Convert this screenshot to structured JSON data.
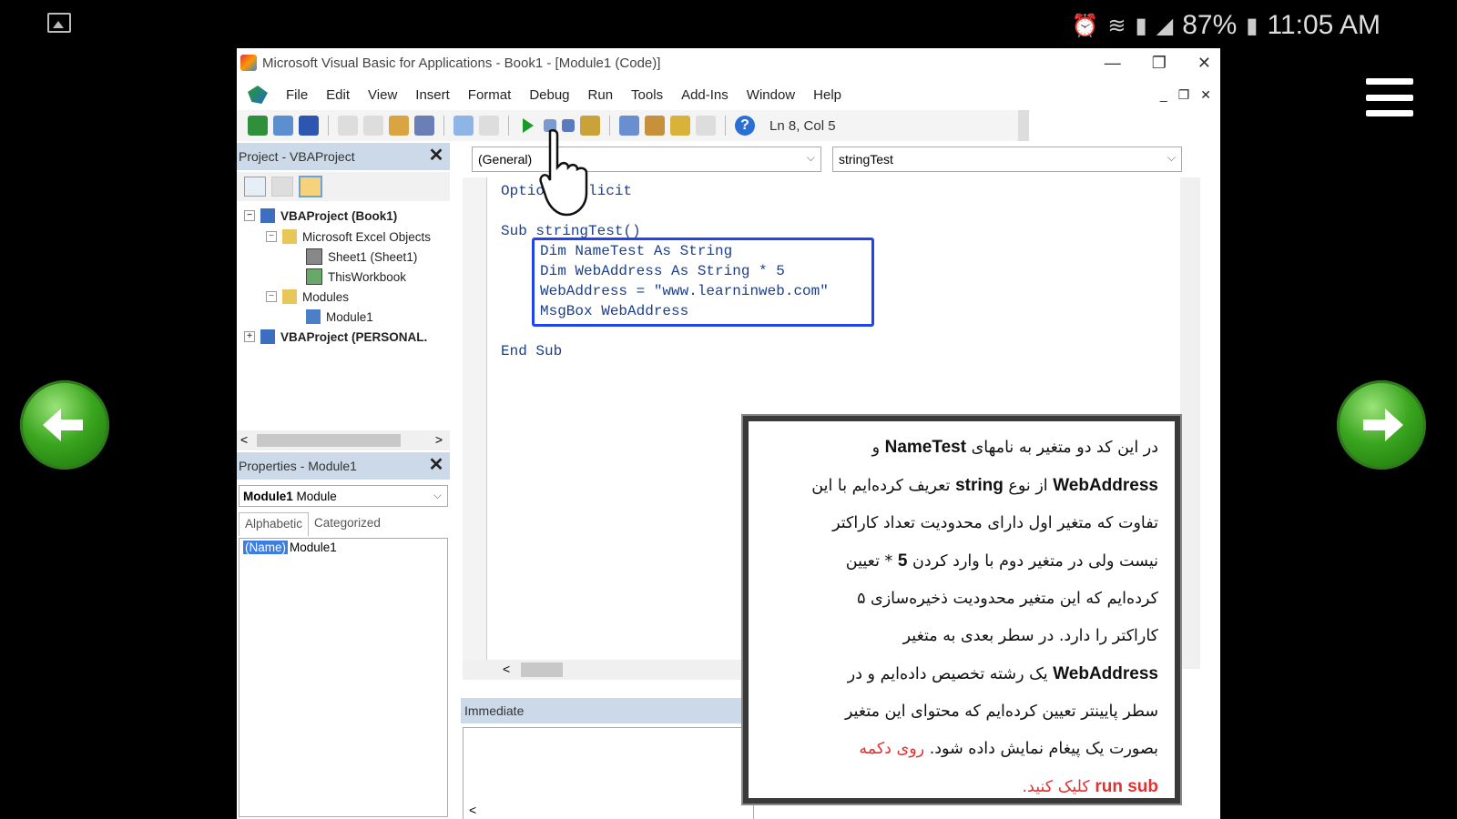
{
  "status_bar": {
    "battery": "87%",
    "time": "11:05 AM"
  },
  "window": {
    "title": "Microsoft Visual Basic for Applications - Book1 - [Module1 (Code)]",
    "min": "—",
    "restore": "❐",
    "close": "✕"
  },
  "menu": {
    "items": [
      "File",
      "Edit",
      "View",
      "Insert",
      "Format",
      "Debug",
      "Run",
      "Tools",
      "Add-Ins",
      "Window",
      "Help"
    ],
    "mdi_min": "_",
    "mdi_restore": "❐",
    "mdi_close": "✕"
  },
  "toolbar": {
    "position": "Ln 8, Col 5"
  },
  "project": {
    "title": "Project - VBAProject",
    "close": "✕",
    "tree": [
      {
        "label": "VBAProject (Book1)",
        "exp": "−"
      },
      {
        "label": "Microsoft Excel Objects",
        "exp": "−"
      },
      {
        "label": "Sheet1 (Sheet1)"
      },
      {
        "label": "ThisWorkbook"
      },
      {
        "label": "Modules",
        "exp": "−"
      },
      {
        "label": "Module1"
      },
      {
        "label": "VBAProject (PERSONAL.",
        "exp": "+"
      }
    ],
    "scroll_left": "<",
    "scroll_right": ">"
  },
  "properties": {
    "title": "Properties - Module1",
    "close": "✕",
    "object_bold": "Module1",
    "object_type": "Module",
    "tabs": [
      "Alphabetic",
      "Categorized"
    ],
    "name_key": "(Name)",
    "name_value": "Module1"
  },
  "code": {
    "object_combo": "(General)",
    "proc_combo": "stringTest",
    "combo_arrow": "⌵",
    "lines": [
      "Option Explicit",
      "Sub stringTest()",
      "Dim NameTest As String",
      "Dim WebAddress As String * 5",
      "WebAddress = \"www.learninweb.com\"",
      "MsgBox WebAddress",
      "End Sub"
    ],
    "hscroll_left": "<"
  },
  "immediate": {
    "title": "Immediate",
    "scroll_left": "<"
  },
  "overlay": {
    "l1a": "در این کد دو متغیر به نامهای ",
    "l1b": "NameTest",
    "l1c": " و",
    "l2a": "WebAddress",
    "l2b": " از نوع ",
    "l2c": "string",
    "l2d": " تعریف کرده‌ایم با این",
    "l3": "تفاوت که متغیر اول دارای محدودیت تعداد کاراکتر",
    "l4a": "نیست ولی در متغیر دوم با وارد کردن ",
    "l4b": "5",
    "l4c": " * تعیین",
    "l5": "کرده‌ایم که این متغیر محدودیت ذخیره‌سازی ۵",
    "l6": "کاراکتر را دارد. در سطر بعدی به متغیر",
    "l7a": "WebAddress",
    "l7b": " یک رشته تخصیص داده‌ایم و در",
    "l8": "سطر پایینتر تعیین کرده‌ایم که محتوای این متغیر",
    "l9a": "بصورت یک پیغام نمایش داده شود. ",
    "l9b": "روی دکمه",
    "l10a": "run sub",
    "l10b": " کلیک کنید."
  },
  "colors": {
    "accent_red": "#e53030",
    "highlight_box": "#2244ee",
    "code_blue": "#1c3f8c",
    "nav_green": "#3aa51e"
  }
}
